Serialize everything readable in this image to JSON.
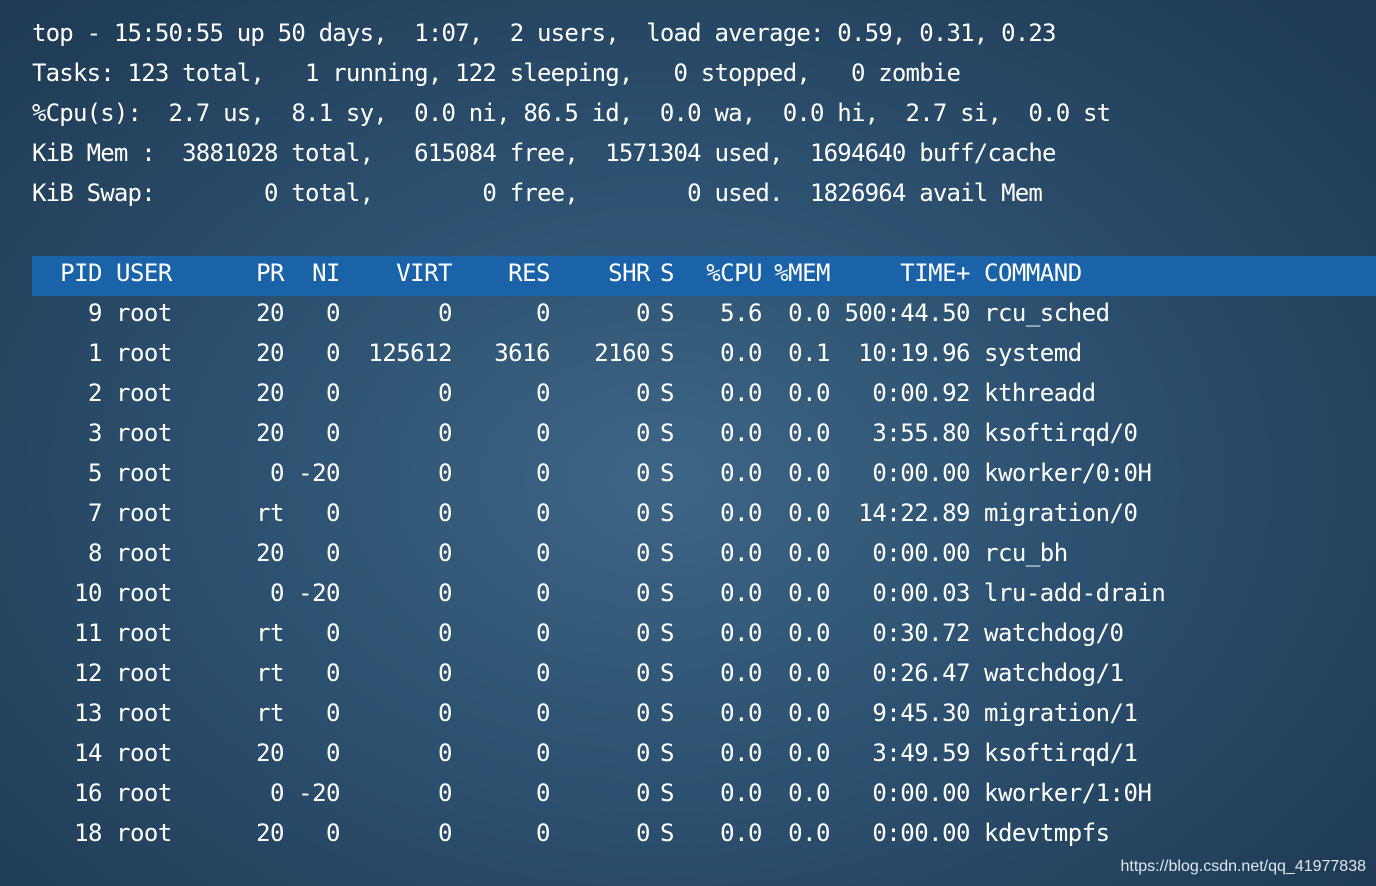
{
  "summary": {
    "line1": "top - 15:50:55 up 50 days,  1:07,  2 users,  load average: 0.59, 0.31, 0.23",
    "line2": "Tasks: 123 total,   1 running, 122 sleeping,   0 stopped,   0 zombie",
    "line3": "%Cpu(s):  2.7 us,  8.1 sy,  0.0 ni, 86.5 id,  0.0 wa,  0.0 hi,  2.7 si,  0.0 st",
    "line4": "KiB Mem :  3881028 total,   615084 free,  1571304 used,  1694640 buff/cache",
    "line5": "KiB Swap:        0 total,        0 free,        0 used.  1826964 avail Mem"
  },
  "header": {
    "pid": "PID",
    "user": "USER",
    "pr": "PR",
    "ni": "NI",
    "virt": "VIRT",
    "res": "RES",
    "shr": "SHR",
    "s": "S",
    "cpu": "%CPU",
    "mem": "%MEM",
    "time": "TIME+",
    "command": "COMMAND"
  },
  "processes": [
    {
      "pid": "9",
      "user": "root",
      "pr": "20",
      "ni": "0",
      "virt": "0",
      "res": "0",
      "shr": "0",
      "s": "S",
      "cpu": "5.6",
      "mem": "0.0",
      "time": "500:44.50",
      "command": "rcu_sched"
    },
    {
      "pid": "1",
      "user": "root",
      "pr": "20",
      "ni": "0",
      "virt": "125612",
      "res": "3616",
      "shr": "2160",
      "s": "S",
      "cpu": "0.0",
      "mem": "0.1",
      "time": "10:19.96",
      "command": "systemd"
    },
    {
      "pid": "2",
      "user": "root",
      "pr": "20",
      "ni": "0",
      "virt": "0",
      "res": "0",
      "shr": "0",
      "s": "S",
      "cpu": "0.0",
      "mem": "0.0",
      "time": "0:00.92",
      "command": "kthreadd"
    },
    {
      "pid": "3",
      "user": "root",
      "pr": "20",
      "ni": "0",
      "virt": "0",
      "res": "0",
      "shr": "0",
      "s": "S",
      "cpu": "0.0",
      "mem": "0.0",
      "time": "3:55.80",
      "command": "ksoftirqd/0"
    },
    {
      "pid": "5",
      "user": "root",
      "pr": "0",
      "ni": "-20",
      "virt": "0",
      "res": "0",
      "shr": "0",
      "s": "S",
      "cpu": "0.0",
      "mem": "0.0",
      "time": "0:00.00",
      "command": "kworker/0:0H"
    },
    {
      "pid": "7",
      "user": "root",
      "pr": "rt",
      "ni": "0",
      "virt": "0",
      "res": "0",
      "shr": "0",
      "s": "S",
      "cpu": "0.0",
      "mem": "0.0",
      "time": "14:22.89",
      "command": "migration/0"
    },
    {
      "pid": "8",
      "user": "root",
      "pr": "20",
      "ni": "0",
      "virt": "0",
      "res": "0",
      "shr": "0",
      "s": "S",
      "cpu": "0.0",
      "mem": "0.0",
      "time": "0:00.00",
      "command": "rcu_bh"
    },
    {
      "pid": "10",
      "user": "root",
      "pr": "0",
      "ni": "-20",
      "virt": "0",
      "res": "0",
      "shr": "0",
      "s": "S",
      "cpu": "0.0",
      "mem": "0.0",
      "time": "0:00.03",
      "command": "lru-add-drain"
    },
    {
      "pid": "11",
      "user": "root",
      "pr": "rt",
      "ni": "0",
      "virt": "0",
      "res": "0",
      "shr": "0",
      "s": "S",
      "cpu": "0.0",
      "mem": "0.0",
      "time": "0:30.72",
      "command": "watchdog/0"
    },
    {
      "pid": "12",
      "user": "root",
      "pr": "rt",
      "ni": "0",
      "virt": "0",
      "res": "0",
      "shr": "0",
      "s": "S",
      "cpu": "0.0",
      "mem": "0.0",
      "time": "0:26.47",
      "command": "watchdog/1"
    },
    {
      "pid": "13",
      "user": "root",
      "pr": "rt",
      "ni": "0",
      "virt": "0",
      "res": "0",
      "shr": "0",
      "s": "S",
      "cpu": "0.0",
      "mem": "0.0",
      "time": "9:45.30",
      "command": "migration/1"
    },
    {
      "pid": "14",
      "user": "root",
      "pr": "20",
      "ni": "0",
      "virt": "0",
      "res": "0",
      "shr": "0",
      "s": "S",
      "cpu": "0.0",
      "mem": "0.0",
      "time": "3:49.59",
      "command": "ksoftirqd/1"
    },
    {
      "pid": "16",
      "user": "root",
      "pr": "0",
      "ni": "-20",
      "virt": "0",
      "res": "0",
      "shr": "0",
      "s": "S",
      "cpu": "0.0",
      "mem": "0.0",
      "time": "0:00.00",
      "command": "kworker/1:0H"
    },
    {
      "pid": "18",
      "user": "root",
      "pr": "20",
      "ni": "0",
      "virt": "0",
      "res": "0",
      "shr": "0",
      "s": "S",
      "cpu": "0.0",
      "mem": "0.0",
      "time": "0:00.00",
      "command": "kdevtmpfs"
    }
  ],
  "watermark": "https://blog.csdn.net/qq_41977838",
  "colors": {
    "background": "#2d5271",
    "header_highlight": "#1a63a8",
    "text": "#ffffff"
  }
}
